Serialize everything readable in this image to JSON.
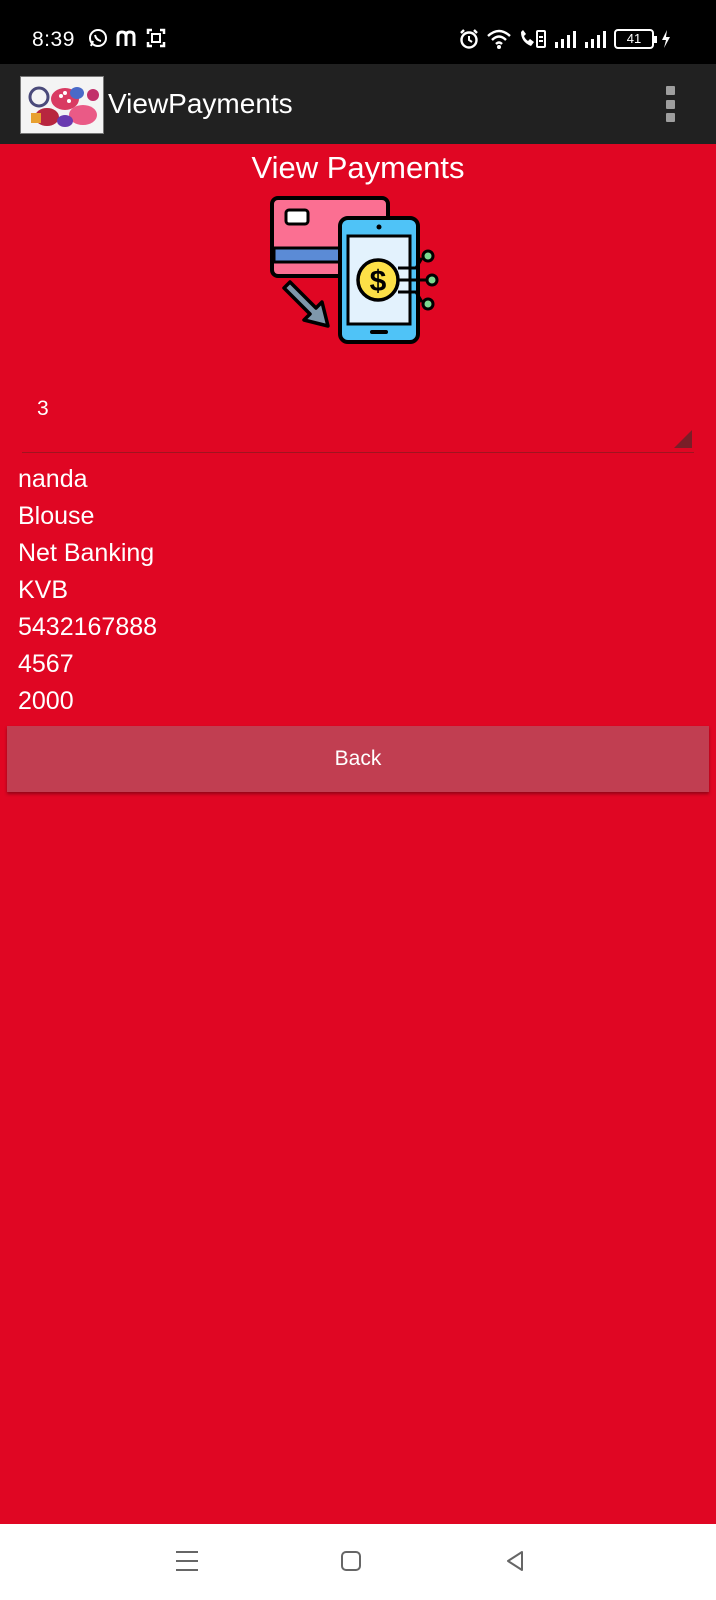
{
  "status_bar": {
    "time": "8:39",
    "left_icons": [
      "whatsapp-icon",
      "m-icon",
      "scan-icon"
    ],
    "right_icons": [
      "alarm-icon",
      "wifi-icon",
      "volte-call-icon",
      "signal-icon",
      "signal-icon"
    ],
    "battery": "41"
  },
  "app_bar": {
    "title": "ViewPayments"
  },
  "page": {
    "heading": "View Payments",
    "spinner_value": "3",
    "details": [
      "nanda",
      "Blouse",
      "Net Banking",
      "KVB",
      "5432167888",
      "4567",
      "2000"
    ],
    "back_label": "Back"
  },
  "colors": {
    "background": "#E00623",
    "app_bar": "#212121",
    "button": "#C13E51"
  }
}
